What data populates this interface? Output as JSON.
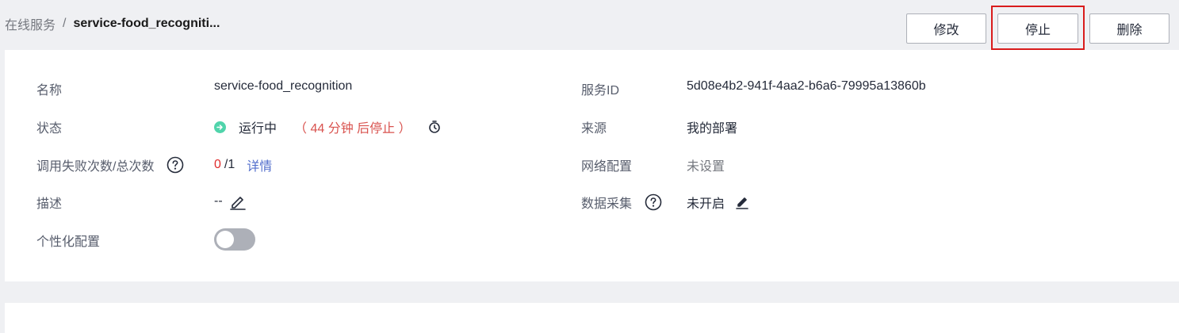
{
  "breadcrumb": {
    "parent": "在线服务",
    "separator": "/",
    "current": "service-food_recogniti..."
  },
  "actions": {
    "edit_label": "修改",
    "stop_label": "停止",
    "delete_label": "删除"
  },
  "details": {
    "name_label": "名称",
    "name_value": "service-food_recognition",
    "status_label": "状态",
    "status_value": "运行中",
    "status_countdown": "（ 44 分钟 后停止 ）",
    "failure_label": "调用失败次数/总次数",
    "failure_count": "0",
    "total_count": "/1",
    "details_link": "详情",
    "description_label": "描述",
    "description_value": "--",
    "personalization_label": "个性化配置",
    "personalization_enabled": false,
    "service_id_label": "服务ID",
    "service_id_value": "5d08e4b2-941f-4aa2-b6a6-79995a13860b",
    "source_label": "来源",
    "source_value": "我的部署",
    "network_label": "网络配置",
    "network_value": "未设置",
    "data_collection_label": "数据采集",
    "data_collection_value": "未开启"
  },
  "colors": {
    "status_running": "#50d4ab",
    "countdown": "#d9534f",
    "link": "#526ecc",
    "highlight": "#d91c1c"
  }
}
